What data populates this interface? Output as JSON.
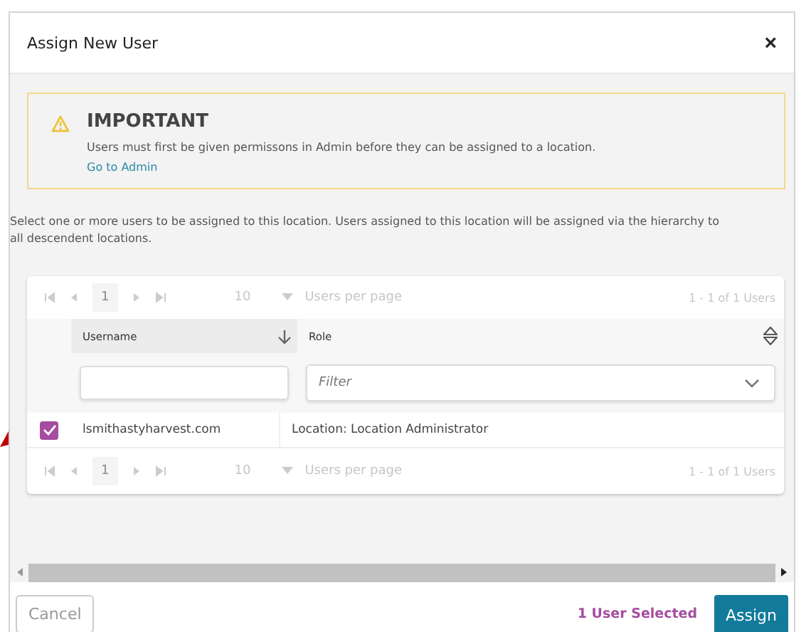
{
  "dialog": {
    "title": "Assign New User",
    "close": "×"
  },
  "notice": {
    "title": "IMPORTANT",
    "message": "Users must first be given permissons in Admin before they can be assigned to a location.",
    "link": "Go to Admin"
  },
  "description": "Select one or more users to be assigned to this location. Users assigned to this location will be assigned via the hierarchy to all descendent locations.",
  "table": {
    "pager_top": {
      "page": "1",
      "page_size": "10",
      "per_page_label": "Users per page",
      "summary": "1 - 1 of 1 Users"
    },
    "columns": [
      {
        "label": "Username",
        "sorted": true,
        "kind": "text"
      },
      {
        "label": "Role",
        "sorted": false,
        "kind": "select",
        "placeholder": "Filter"
      }
    ],
    "rows": [
      {
        "selected": true,
        "cells": [
          "lsmithastyharvest.com",
          "Location: Location Administrator"
        ]
      }
    ],
    "pager_bottom": {
      "page": "1",
      "page_size": "10",
      "per_page_label": "Users per page",
      "summary": "1 - 1 of 1 Users"
    }
  },
  "footer": {
    "cancel": "Cancel",
    "selection_count": "1 User Selected",
    "assign": "Assign"
  }
}
